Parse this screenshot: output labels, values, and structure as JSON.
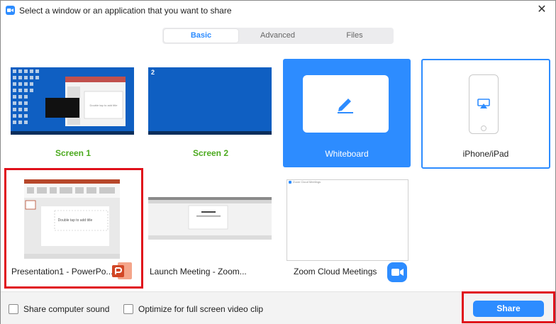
{
  "window": {
    "title": "Select a window or an application that you want to share",
    "close_glyph": "✕"
  },
  "tabs": [
    {
      "label": "Basic",
      "active": true
    },
    {
      "label": "Advanced",
      "active": false
    },
    {
      "label": "Files",
      "active": false
    }
  ],
  "tiles": {
    "screen1": {
      "label": "Screen 1"
    },
    "screen2": {
      "label": "Screen 2",
      "badge": "2"
    },
    "whiteboard": {
      "label": "Whiteboard",
      "icon": "pen-icon"
    },
    "iphone": {
      "label": "iPhone/iPad",
      "icon": "airplay-icon"
    },
    "presentation": {
      "label": "Presentation1 - PowerPo...",
      "icon": "powerpoint-icon",
      "slide_text": "Double tap to add title"
    },
    "launch_meeting": {
      "label": "Launch Meeting - Zoom..."
    },
    "cloud_meetings": {
      "label": "Zoom Cloud Meetings",
      "icon": "zoom-icon",
      "thumb_caption": "Zoom Cloud Meetings"
    }
  },
  "footer": {
    "share_sound": "Share computer sound",
    "optimize_video": "Optimize for full screen video clip",
    "share_button": "Share"
  },
  "colors": {
    "accent": "#2d8cff",
    "screen_label": "#4caa1f",
    "highlight": "#e0101b",
    "desktop": "#0f5fc2"
  }
}
